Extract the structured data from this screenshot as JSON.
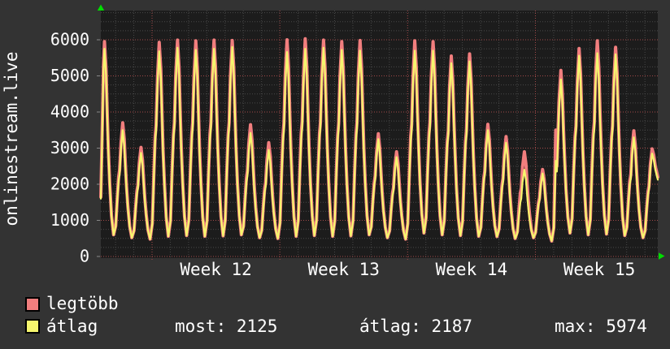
{
  "title_vertical": "onlinestream.live",
  "colors": {
    "background": "#333333",
    "plot_background": "#1c1c1c",
    "grid_minor": "#484848",
    "grid_major": "#a34a4a",
    "axis_tick": "#888888",
    "text": "#ffffff",
    "arrow_green": "#00dd00",
    "legtobb_line": "#f17e7e",
    "atlag_line": "#f6f66e"
  },
  "legend": [
    {
      "label": "legtöbb",
      "color": "#f17e7e"
    },
    {
      "label": "átlag",
      "color": "#f6f66e"
    }
  ],
  "stats": [
    {
      "text": "most: 2125"
    },
    {
      "text": "átlag: 2187"
    },
    {
      "text": "max: 5974"
    }
  ],
  "chart_data": {
    "type": "line",
    "title": "onlinestream.live",
    "ylabel": "onlinestream.live",
    "ylim": [
      0,
      6800
    ],
    "y_ticks": [
      0,
      1000,
      2000,
      3000,
      4000,
      5000,
      6000
    ],
    "x_tick_labels": [
      "Week 12",
      "Week 13",
      "Week 14",
      "Week 15"
    ],
    "grid": true,
    "legend_position": "bottom-left",
    "description": "Daily viewer-count cycles; one peak per day, troughs ~500",
    "series": [
      {
        "name": "legtöbb",
        "color": "#f17e7e",
        "start_value": 1650,
        "end_value": 2200,
        "daily_peaks": [
          5950,
          3700,
          3020,
          5930,
          5990,
          5970,
          5990,
          5980,
          3650,
          3150,
          6000,
          6030,
          5990,
          5950,
          5980,
          3400,
          2900,
          5970,
          5950,
          5550,
          5610,
          3660,
          3320,
          2900,
          2410,
          5150,
          5760,
          5970,
          5790,
          3480,
          2980
        ]
      },
      {
        "name": "átlag",
        "color": "#f6f66e",
        "start_value": 1600,
        "end_value": 2125,
        "daily_peaks": [
          5750,
          3500,
          2870,
          5680,
          5780,
          5720,
          5750,
          5800,
          3420,
          2950,
          5660,
          5750,
          5780,
          5720,
          5700,
          3250,
          2750,
          5700,
          5700,
          5350,
          5400,
          3500,
          3150,
          2400,
          2300,
          4900,
          5560,
          5630,
          5600,
          3300,
          2850
        ]
      }
    ],
    "daily_troughs": [
      600,
      600,
      520,
      480,
      560,
      580,
      560,
      570,
      600,
      520,
      500,
      560,
      580,
      560,
      570,
      600,
      520,
      480,
      650,
      600,
      580,
      560,
      550,
      500,
      520,
      430,
      650,
      600,
      620,
      580,
      520
    ],
    "day25_prespike": {
      "legtobb": [
        3500,
        2500
      ],
      "atlag": [
        2650,
        2350
      ]
    },
    "stats_row": {
      "most": 2125,
      "atlag": 2187,
      "max": 5974
    }
  }
}
